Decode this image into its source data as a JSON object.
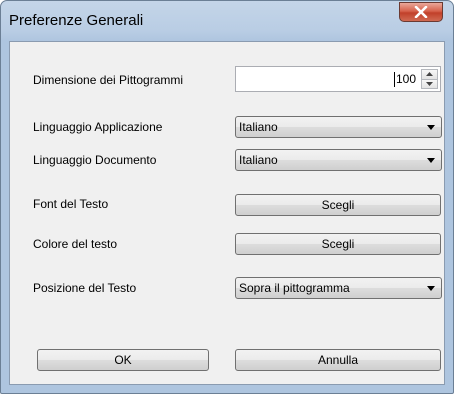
{
  "window": {
    "title": "Preferenze Generali",
    "close_icon": "close-icon"
  },
  "form": {
    "pictogram_size": {
      "label": "Dimensione dei Pittogrammi",
      "value": "100"
    },
    "app_language": {
      "label": "Linguaggio Applicazione",
      "selected": "Italiano"
    },
    "doc_language": {
      "label": "Linguaggio Documento",
      "selected": "Italiano"
    },
    "text_font": {
      "label": "Font del Testo",
      "button": "Scegli"
    },
    "text_color": {
      "label": "Colore del testo",
      "button": "Scegli"
    },
    "text_position": {
      "label": "Posizione del Testo",
      "selected": "Sopra il pittogramma"
    }
  },
  "footer": {
    "ok_label": "OK",
    "cancel_label": "Annulla"
  },
  "colors": {
    "title_bar": "#b9cde4",
    "close_button": "#c7452f",
    "dialog_bg": "#f0f0f0"
  }
}
